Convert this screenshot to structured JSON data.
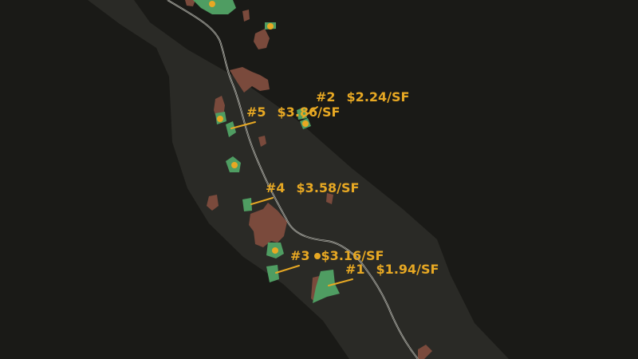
{
  "map": {
    "colors": {
      "background": "#1a1a17",
      "corridor": "#2a2a26",
      "road": "#bdbdb6",
      "parcel_green": "#4f9d62",
      "parcel_brown": "#7a4a3c",
      "marker": "#e7a823",
      "label": "#e7a823"
    }
  },
  "comps": [
    {
      "rank": "#1",
      "price": "$1.94/SF"
    },
    {
      "rank": "#2",
      "price": "$2.24/SF"
    },
    {
      "rank": "#3",
      "price": "$3.16/SF"
    },
    {
      "rank": "#4",
      "price": "$3.58/SF"
    },
    {
      "rank": "#5",
      "price": "$3.86/SF"
    }
  ]
}
